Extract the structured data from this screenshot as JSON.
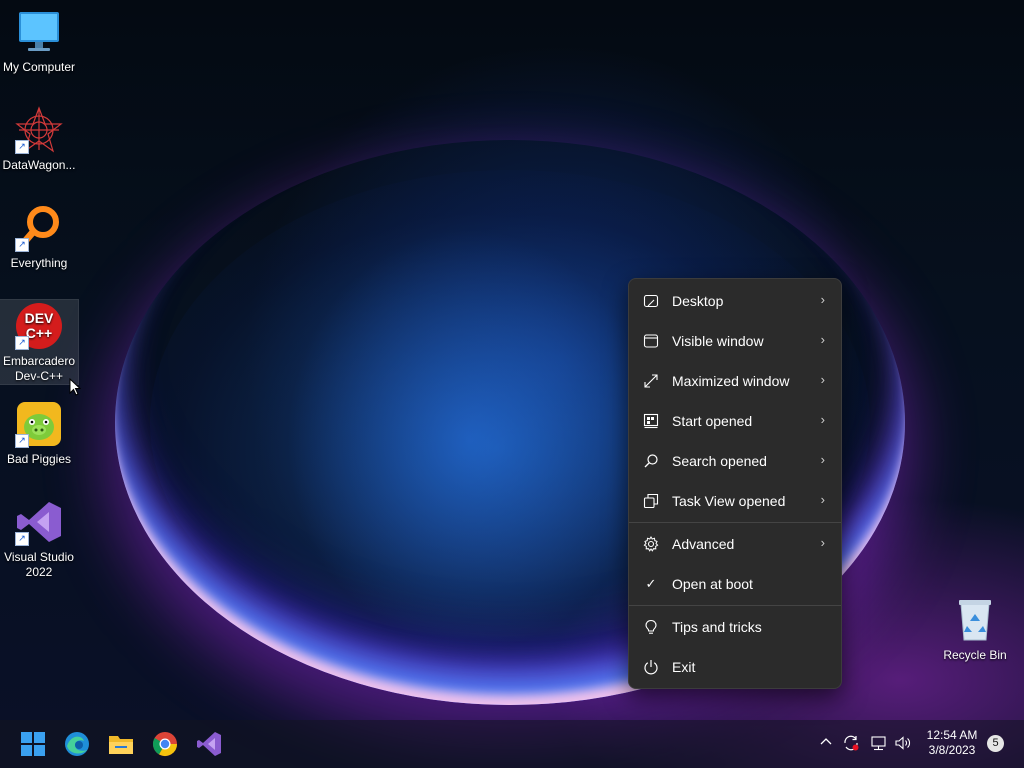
{
  "desktop_icons": [
    {
      "label": "My Computer",
      "icon": "monitor-icon"
    },
    {
      "label": "DataWagon...",
      "icon": "datawagon-icon"
    },
    {
      "label": "Everything",
      "icon": "magnifier-icon"
    },
    {
      "label": "Embarcadero Dev-C++",
      "icon": "devcpp-icon"
    },
    {
      "label": "Bad Piggies",
      "icon": "bad-piggies-icon"
    },
    {
      "label": "Visual Studio 2022",
      "icon": "visual-studio-icon"
    },
    {
      "label": "Recycle Bin",
      "icon": "recycle-bin-icon"
    }
  ],
  "devcpp_logo": {
    "line1": "DEV",
    "line2": "C++"
  },
  "context_menu": {
    "items": [
      {
        "label": "Desktop",
        "icon": "desktop-icon",
        "submenu": true
      },
      {
        "label": "Visible window",
        "icon": "window-icon",
        "submenu": true
      },
      {
        "label": "Maximized window",
        "icon": "maximize-icon",
        "submenu": true
      },
      {
        "label": "Start opened",
        "icon": "start-menu-icon",
        "submenu": true
      },
      {
        "label": "Search opened",
        "icon": "search-icon",
        "submenu": true
      },
      {
        "label": "Task View opened",
        "icon": "task-view-icon",
        "submenu": true
      },
      {
        "label": "Advanced",
        "icon": "gear-icon",
        "submenu": true
      },
      {
        "label": "Open at boot",
        "icon": "checkmark-icon",
        "submenu": false,
        "checked": true
      },
      {
        "label": "Tips and tricks",
        "icon": "lightbulb-icon",
        "submenu": false
      },
      {
        "label": "Exit",
        "icon": "power-icon",
        "submenu": false
      }
    ],
    "chevron": "›",
    "check": "✓"
  },
  "taskbar": {
    "apps": [
      "windows-start-icon",
      "edge-icon",
      "file-explorer-icon",
      "chrome-icon",
      "visual-studio-icon"
    ],
    "tray": {
      "overflow": "^",
      "time": "12:54 AM",
      "date": "3/8/2023",
      "notification_count": "5"
    }
  },
  "colors": {
    "menu_bg": "#2b2b2b",
    "menu_text": "#ffffff",
    "accent": "#0078d4"
  }
}
